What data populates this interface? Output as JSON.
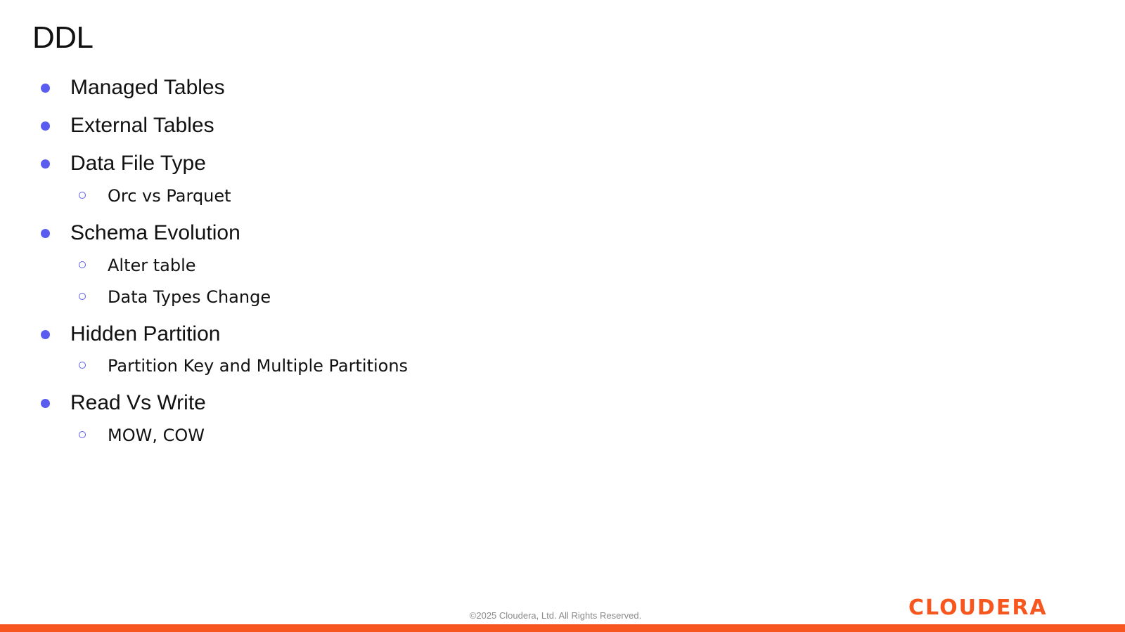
{
  "slide": {
    "title": "DDL"
  },
  "bullets": [
    "Managed Tables",
    "External Tables",
    "Data File Type",
    "Orc vs Parquet",
    "Schema Evolution",
    "Alter table",
    "Data Types Change",
    "Hidden Partition",
    "Partition Key and Multiple Partitions",
    "Read Vs Write",
    "MOW, COW"
  ],
  "footer": {
    "copyright": "©2025 Cloudera, Ltd. All Rights Reserved.",
    "logo_text": "CLOUDERA"
  },
  "colors": {
    "bullet": "#5a5cf0",
    "brand": "#f7571e",
    "text": "#111111",
    "footer_text": "#8a8a8a"
  }
}
